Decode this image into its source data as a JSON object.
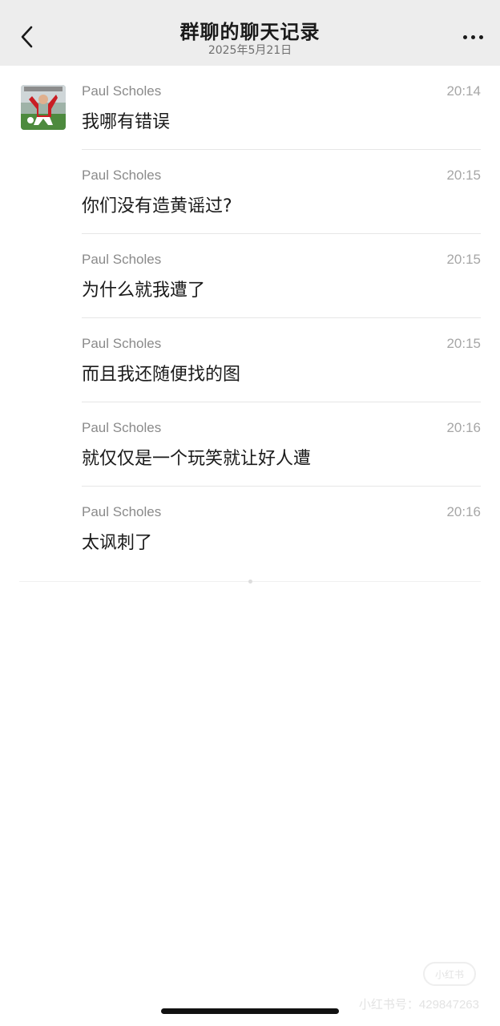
{
  "nav": {
    "title": "群聊的聊天记录",
    "subtitle": "2025年5月21日"
  },
  "messages": [
    {
      "sender": "Paul Scholes",
      "time": "20:14",
      "text": "我哪有错误"
    },
    {
      "sender": "Paul Scholes",
      "time": "20:15",
      "text": "你们没有造黄谣过?"
    },
    {
      "sender": "Paul Scholes",
      "time": "20:15",
      "text": "为什么就我遭了"
    },
    {
      "sender": "Paul Scholes",
      "time": "20:15",
      "text": "而且我还随便找的图"
    },
    {
      "sender": "Paul Scholes",
      "time": "20:16",
      "text": "就仅仅是一个玩笑就让好人遭"
    },
    {
      "sender": "Paul Scholes",
      "time": "20:16",
      "text": "太讽刺了"
    }
  ],
  "watermark": {
    "logo": "小红书",
    "text": "小红书号：429847263"
  }
}
